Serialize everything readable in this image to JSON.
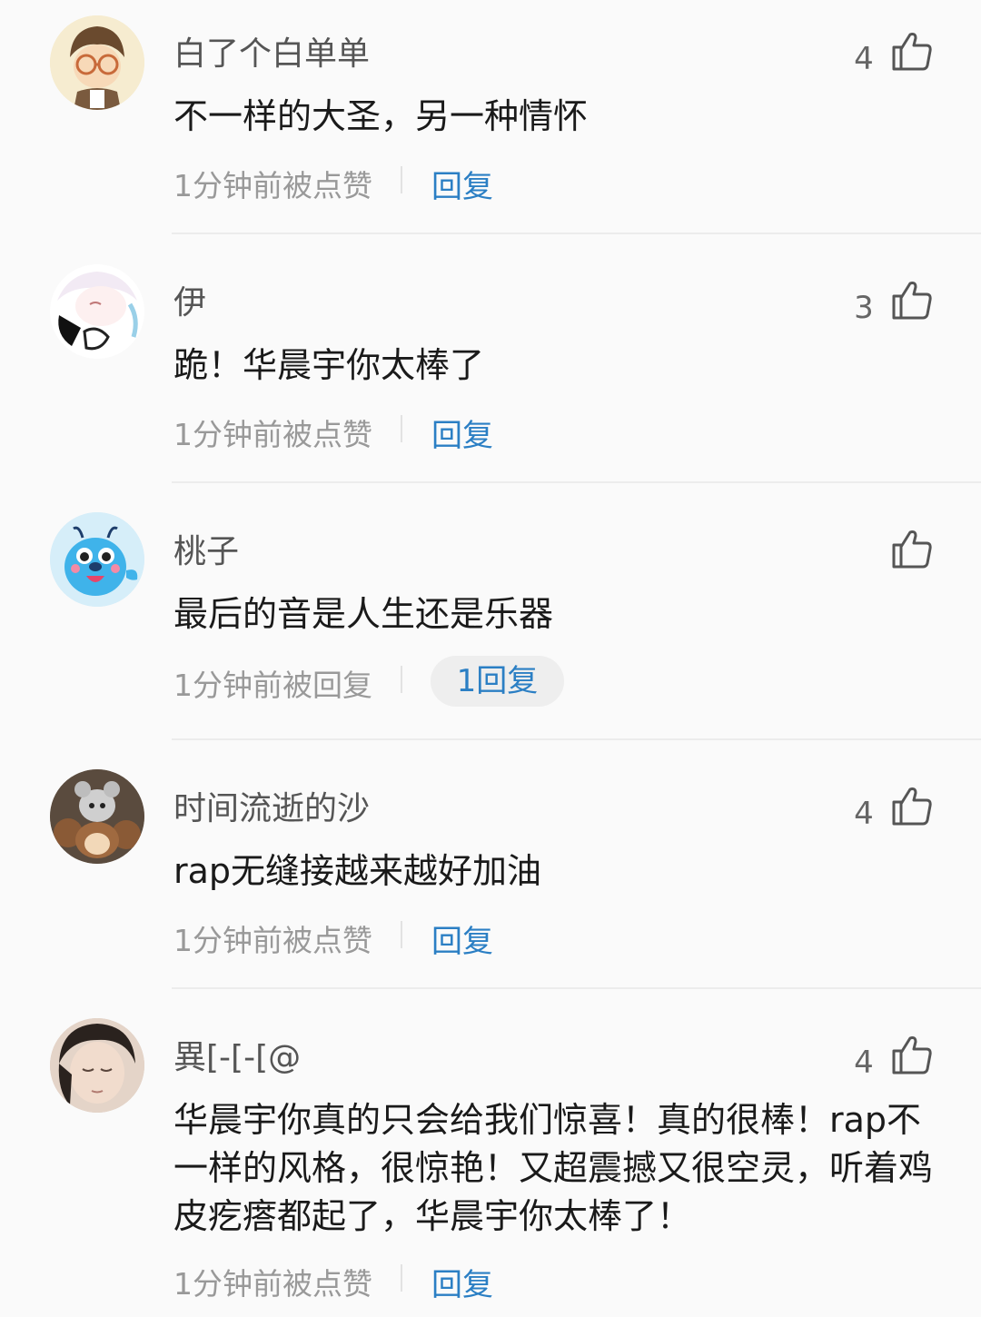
{
  "comments": [
    {
      "username": "白了个白单单",
      "text": "不一样的大圣，另一种情怀",
      "meta": "1分钟前被点赞",
      "reply": "回复",
      "likes": "4",
      "avatar": "cartoon-boy-with-glasses-avatar"
    },
    {
      "username": "伊",
      "text": "跪！华晨宇你太棒了",
      "meta": "1分钟前被点赞",
      "reply": "回复",
      "likes": "3",
      "avatar": "anime-girl-sketch-avatar"
    },
    {
      "username": "桃子",
      "text": "最后的音是人生还是乐器",
      "meta": "1分钟前被回复",
      "reply": "1回复",
      "likes": "",
      "avatar": "blue-cartoon-creature-avatar"
    },
    {
      "username": "时间流逝的沙",
      "text": "rap无缝接越来越好加油",
      "meta": "1分钟前被点赞",
      "reply": "回复",
      "likes": "4",
      "avatar": "plush-toy-photo-avatar"
    },
    {
      "username": "異[-[-[@",
      "text": "华晨宇你真的只会给我们惊喜！真的很棒！rap不一样的风格，很惊艳！又超震撼又很空灵，听着鸡皮疙瘩都起了，华晨宇你太棒了！",
      "meta": "1分钟前被点赞",
      "reply": "回复",
      "likes": "4",
      "avatar": "sleeping-person-photo-avatar"
    }
  ],
  "colors": {
    "background": "#fafafa",
    "link": "#2b7fc4",
    "meta_text": "#999999",
    "divider": "#ececec"
  }
}
